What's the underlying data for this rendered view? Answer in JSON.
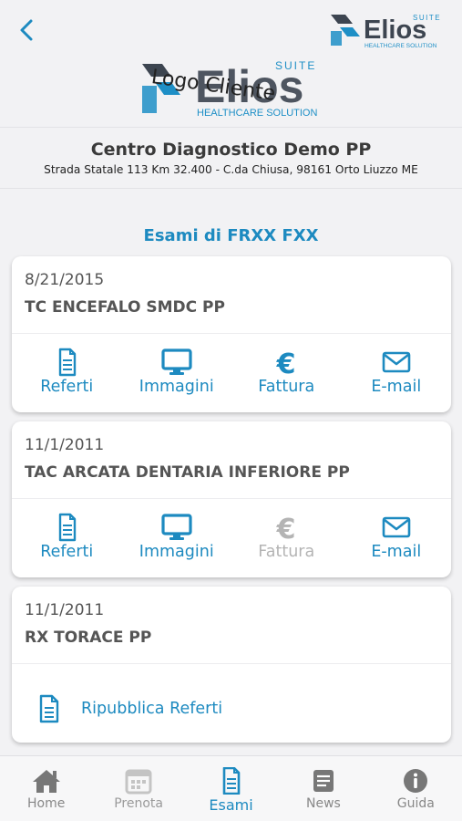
{
  "header": {
    "back_label": "<",
    "brand": {
      "name": "Elios",
      "suite": "SUITE",
      "tagline": "HEALTHCARE SOLUTION"
    }
  },
  "client_logo": {
    "name": "Elios",
    "suite": "SUITE",
    "tagline": "HEALTHCARE SOLUTION",
    "overlay_text": "Logo Cliente"
  },
  "center": {
    "name": "Centro Diagnostico Demo PP",
    "address": "Strada Statale 113 Km 32.400 - C.da Chiusa, 98161 Orto Liuzzo ME"
  },
  "section_title": "Esami di FRXX FXX",
  "exams": [
    {
      "date": "8/21/2015",
      "title": "TC ENCEFALO SMDC PP",
      "actions": [
        {
          "label": "Referti",
          "icon": "document-icon",
          "enabled": true
        },
        {
          "label": "Immagini",
          "icon": "monitor-icon",
          "enabled": true
        },
        {
          "label": "Fattura",
          "icon": "euro-icon",
          "enabled": true
        },
        {
          "label": "E-mail",
          "icon": "envelope-icon",
          "enabled": true
        }
      ]
    },
    {
      "date": "11/1/2011",
      "title": "TAC ARCATA DENTARIA INFERIORE PP",
      "actions": [
        {
          "label": "Referti",
          "icon": "document-icon",
          "enabled": true
        },
        {
          "label": "Immagini",
          "icon": "monitor-icon",
          "enabled": true
        },
        {
          "label": "Fattura",
          "icon": "euro-icon",
          "enabled": false
        },
        {
          "label": "E-mail",
          "icon": "envelope-icon",
          "enabled": true
        }
      ]
    },
    {
      "date": "11/1/2011",
      "title": "RX TORACE PP",
      "republish_label": "Ripubblica Referti"
    }
  ],
  "tabs": [
    {
      "label": "Home",
      "icon": "home-icon",
      "state": "normal"
    },
    {
      "label": "Prenota",
      "icon": "calendar-icon",
      "state": "muted"
    },
    {
      "label": "Esami",
      "icon": "document-icon",
      "state": "active"
    },
    {
      "label": "News",
      "icon": "news-icon",
      "state": "normal"
    },
    {
      "label": "Guida",
      "icon": "info-icon",
      "state": "normal"
    }
  ],
  "colors": {
    "accent": "#1d8ac0",
    "background": "#f2f2f4",
    "disabled": "#b4b4b4",
    "logo_dark": "#3d4550",
    "logo_blue": "#1e8fc6"
  }
}
